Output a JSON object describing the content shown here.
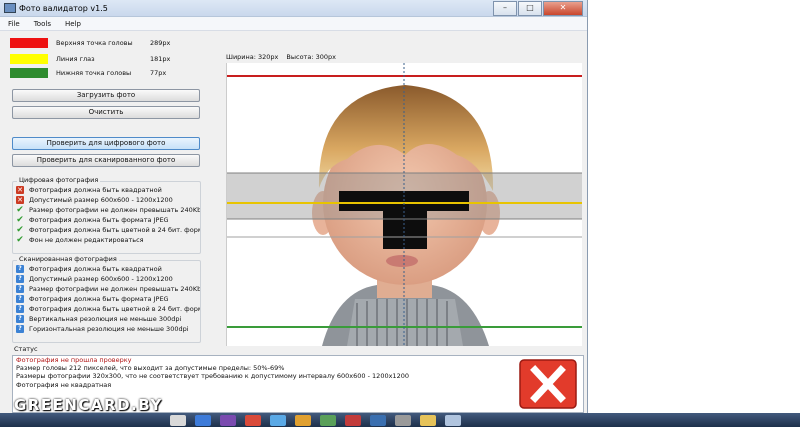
{
  "window": {
    "title": "Фото валидатор v1.5"
  },
  "menu": [
    "File",
    "Tools",
    "Help"
  ],
  "legend": [
    {
      "label": "Верхняя точка головы",
      "value": "289px",
      "color": "#ee1111"
    },
    {
      "label": "Линия глаз",
      "value": "181px",
      "color": "#ffff00"
    },
    {
      "label": "Нижняя точка головы",
      "value": "77px",
      "color": "#2e8b2e"
    }
  ],
  "buttons": {
    "load": "Загрузить фото",
    "clear": "Очистить",
    "check_digital": "Проверить для цифрового фото",
    "check_scanned": "Проверить для сканированного фото"
  },
  "digital": {
    "title": "Цифровая фотография",
    "items": [
      {
        "text": "Фотография должна быть квадратной",
        "status": "fail"
      },
      {
        "text": "Допустимый размер 600x600 - 1200x1200",
        "status": "fail"
      },
      {
        "text": "Размер фотографии не должен превышать 240Kb",
        "status": "pass"
      },
      {
        "text": "Фотография должна быть формата JPEG",
        "status": "pass"
      },
      {
        "text": "Фотография должна быть цветной в 24 бит. формате",
        "status": "pass"
      },
      {
        "text": "Фон не должен редактироваться",
        "status": "pass"
      }
    ]
  },
  "scanned": {
    "title": "Сканированная фотография",
    "items": [
      {
        "text": "Фотография должна быть квадратной"
      },
      {
        "text": "Допустимый размер 600x600 - 1200x1200"
      },
      {
        "text": "Размер фотографии не должен превышать 240Kb"
      },
      {
        "text": "Фотография должна быть формата JPEG"
      },
      {
        "text": "Фотография должна быть цветной в 24 бит. формате"
      },
      {
        "text": "Вертикальная резолюция не меньше 300dpi"
      },
      {
        "text": "Горизонтальная резолюция не меньше 300dpi"
      }
    ]
  },
  "photo": {
    "width_label": "Ширина: 320px",
    "height_label": "Высота: 300px"
  },
  "status": {
    "title": "Статус",
    "lines": [
      {
        "text": "Фотография не прошла проверку",
        "error": true
      },
      {
        "text": "Размер головы 212 пикселей, что выходит за допустимые пределы: 50%-69%",
        "error": false
      },
      {
        "text": "Размеры фотографии 320x300, что не соответствует требованию к допустимому интервалу 600x600 - 1200x1200",
        "error": false
      },
      {
        "text": "Фотография не квадратная",
        "error": false
      }
    ]
  },
  "watermark": "GREENCARD.BY",
  "icons": {
    "fail": "red-x-icon",
    "pass": "green-check-icon",
    "unknown": "question-icon"
  }
}
